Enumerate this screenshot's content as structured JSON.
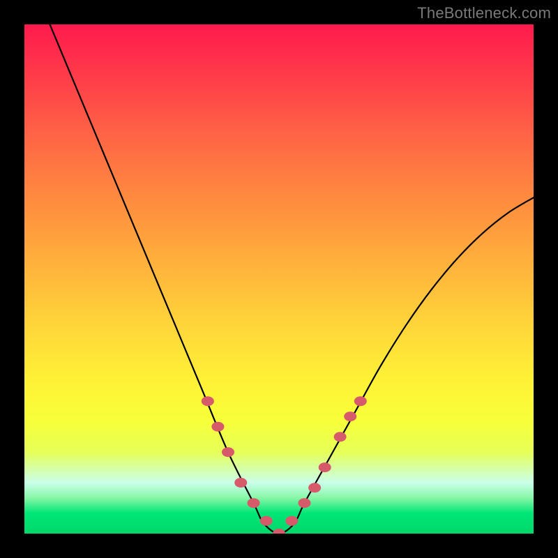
{
  "watermark": "TheBottleneck.com",
  "chart_data": {
    "type": "line",
    "title": "",
    "xlabel": "",
    "ylabel": "",
    "xlim": [
      0,
      100
    ],
    "ylim": [
      0,
      100
    ],
    "series": [
      {
        "name": "bottleneck-curve",
        "x": [
          5,
          10,
          15,
          20,
          25,
          30,
          35,
          40,
          45,
          47,
          50,
          53,
          55,
          60,
          65,
          70,
          75,
          80,
          85,
          90,
          95,
          100
        ],
        "values": [
          100,
          88,
          76,
          64,
          52,
          40,
          28,
          16,
          6,
          2,
          0,
          2,
          6,
          15,
          24,
          33,
          41,
          48,
          54,
          59,
          63,
          66
        ]
      }
    ],
    "markers": {
      "name": "highlight-points",
      "color": "#d65a6a",
      "x": [
        36,
        38,
        40,
        42.5,
        45,
        47.5,
        50,
        52.5,
        55,
        57,
        59,
        62,
        64,
        66
      ],
      "values": [
        26,
        21,
        16,
        10,
        6,
        2.5,
        0,
        2.5,
        6,
        9,
        13,
        19,
        23,
        26
      ]
    }
  }
}
